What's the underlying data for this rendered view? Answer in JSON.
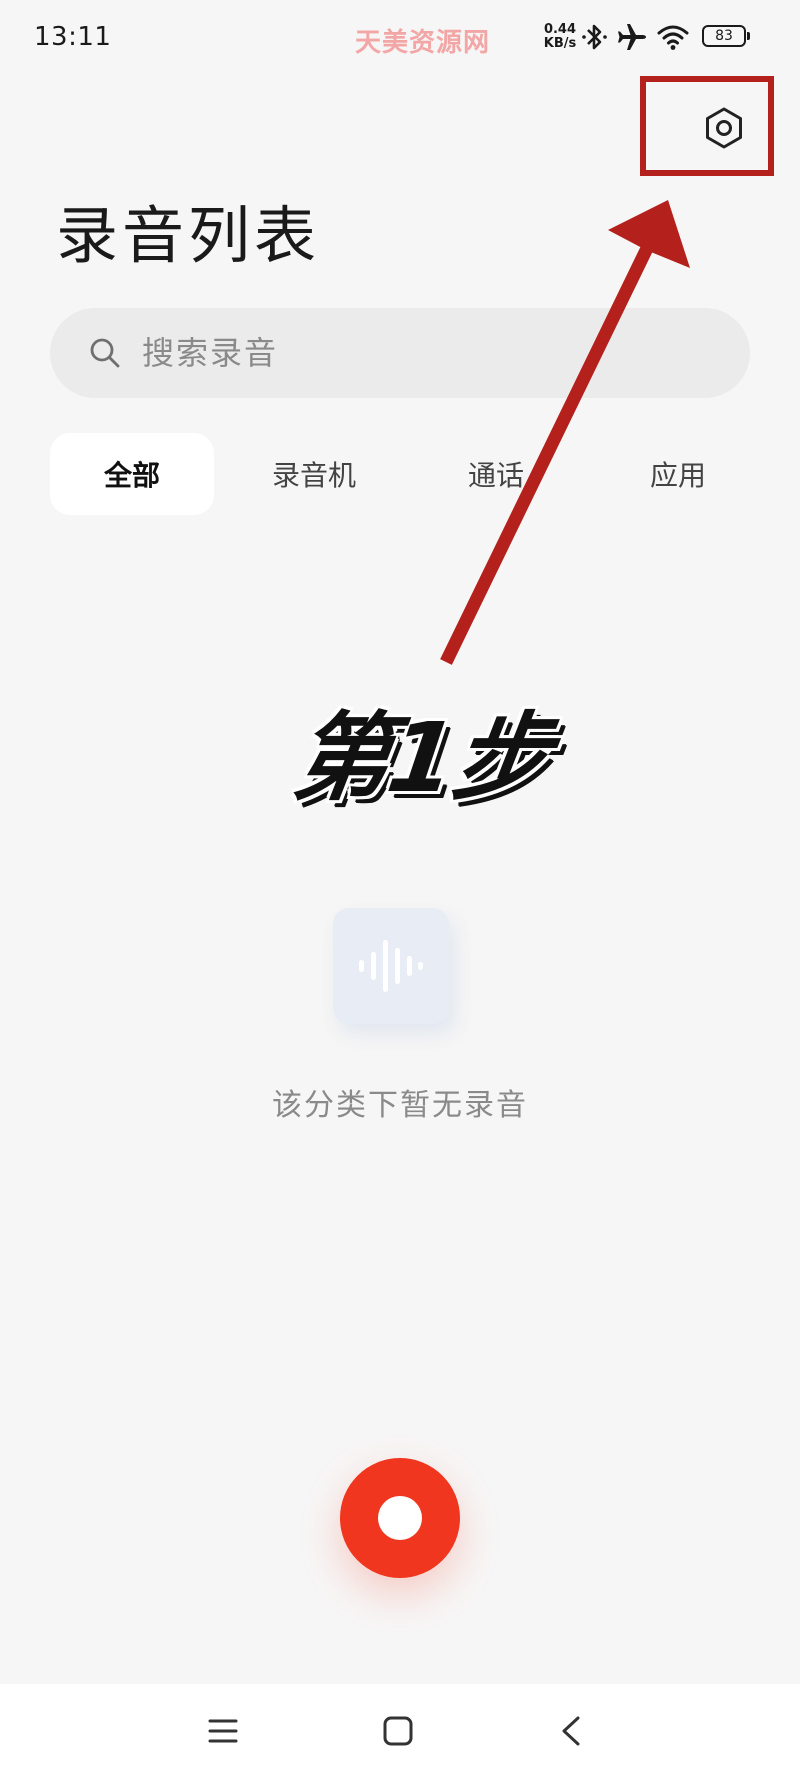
{
  "status_bar": {
    "time": "13:11",
    "watermark": "天美资源网",
    "net_speed_value": "0.44",
    "net_speed_unit": "KB/s",
    "battery": "83",
    "icons": [
      "bluetooth-icon",
      "airplane-icon",
      "wifi-icon",
      "battery-icon"
    ]
  },
  "header": {
    "settings_icon": "settings-hex-icon",
    "title": "录音列表"
  },
  "search": {
    "placeholder": "搜索录音",
    "value": ""
  },
  "tabs": [
    {
      "label": "全部",
      "active": true
    },
    {
      "label": "录音机",
      "active": false
    },
    {
      "label": "通话",
      "active": false
    },
    {
      "label": "应用",
      "active": false
    }
  ],
  "annotation": {
    "step_label": "第1步",
    "color": "#b4211c"
  },
  "empty_state": {
    "icon": "waveform-icon",
    "message": "该分类下暂无录音"
  },
  "record": {
    "icon": "record-icon",
    "color": "#f0361e"
  },
  "nav": {
    "icons": [
      "menu-icon",
      "home-square-icon",
      "back-chevron-icon"
    ]
  }
}
